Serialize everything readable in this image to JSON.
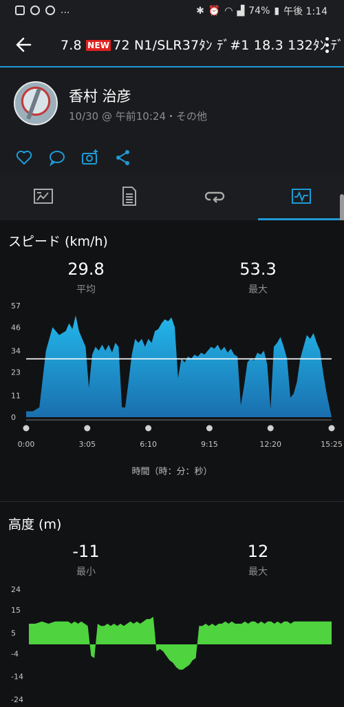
{
  "status": {
    "battery": "74%",
    "time": "午後 1:14",
    "more": "..."
  },
  "header": {
    "title_prefix": "7.8",
    "new_badge": "NEW",
    "title_rest": "72  N1/SLR37ﾀﾝ ﾃﾞ#1  18.3  132ﾀﾝ ﾃﾞ"
  },
  "profile": {
    "name": "香村 治彦",
    "subtitle": "10/30 @ 午前10:24・その他"
  },
  "actions": [
    "like",
    "comment",
    "add-photo",
    "share"
  ],
  "tabs": [
    "summary",
    "details",
    "laps",
    "charts"
  ],
  "speed": {
    "title": "スピード (km/h)",
    "avg_value": "29.8",
    "avg_label": "平均",
    "max_value": "53.3",
    "max_label": "最大",
    "xlabel": "時間（時：分：秒）"
  },
  "altitude": {
    "title": "高度 (m)",
    "min_value": "-11",
    "min_label": "最小",
    "max_value": "12",
    "max_label": "最大"
  },
  "colors": {
    "accent": "#1e9bd7",
    "speed_fill_top": "#22b7ea",
    "speed_fill_bottom": "#1a6fae",
    "alt_fill": "#4fd33f"
  },
  "chart_data": [
    {
      "type": "area",
      "title": "スピード (km/h)",
      "xlabel": "時間（時：分：秒）",
      "ylabel": "",
      "x_ticks": [
        "0:00",
        "3:05",
        "6:10",
        "9:15",
        "12:20",
        "15:25"
      ],
      "y_ticks": [
        0,
        11,
        23,
        34,
        46,
        57
      ],
      "xlim": [
        0,
        925
      ],
      "ylim": [
        0,
        57
      ],
      "average_line": 29.8,
      "series": [
        {
          "x": [
            0,
            20,
            40,
            60,
            80,
            100,
            120,
            130,
            140,
            150,
            160,
            170,
            180,
            190,
            200,
            210,
            220,
            230,
            240,
            250,
            260,
            270,
            280,
            290,
            300,
            310,
            320,
            330,
            340,
            350,
            360,
            370,
            380,
            390,
            400,
            410,
            420,
            430,
            440,
            450,
            460,
            470,
            480,
            490,
            500,
            510,
            520,
            530,
            540,
            550,
            560,
            570,
            580,
            590,
            600,
            610,
            620,
            630,
            640,
            650,
            660,
            670,
            680,
            690,
            700,
            710,
            720,
            730,
            740,
            750,
            760,
            770,
            780,
            790,
            800,
            810,
            820,
            830,
            840,
            850,
            860,
            870,
            880,
            890,
            900,
            910,
            925
          ],
          "y": [
            3,
            3,
            5,
            34,
            46,
            42,
            44,
            48,
            45,
            52,
            44,
            40,
            36,
            15,
            32,
            36,
            34,
            37,
            34,
            37,
            33,
            38,
            36,
            5,
            5,
            18,
            32,
            40,
            38,
            40,
            36,
            40,
            38,
            44,
            45,
            48,
            50,
            49,
            51,
            46,
            20,
            30,
            28,
            31,
            30,
            32,
            31,
            33,
            32,
            34,
            36,
            35,
            37,
            34,
            36,
            33,
            35,
            32,
            31,
            6,
            16,
            28,
            30,
            29,
            33,
            32,
            34,
            27,
            4,
            36,
            38,
            41,
            36,
            30,
            10,
            12,
            18,
            30,
            36,
            42,
            40,
            43,
            38,
            34,
            22,
            12,
            0
          ]
        }
      ]
    },
    {
      "type": "area",
      "title": "高度 (m)",
      "xlabel": "",
      "ylabel": "",
      "y_ticks": [
        24,
        15,
        5,
        -4,
        -14,
        -24
      ],
      "xlim": [
        0,
        925
      ],
      "ylim": [
        -24,
        24
      ],
      "series": [
        {
          "x": [
            0,
            20,
            40,
            60,
            80,
            100,
            120,
            130,
            140,
            150,
            160,
            170,
            180,
            190,
            200,
            210,
            220,
            230,
            240,
            250,
            260,
            270,
            280,
            290,
            300,
            310,
            320,
            330,
            340,
            350,
            360,
            370,
            380,
            390,
            400,
            410,
            420,
            430,
            440,
            450,
            460,
            470,
            480,
            490,
            500,
            510,
            520,
            530,
            540,
            550,
            560,
            570,
            580,
            590,
            600,
            610,
            620,
            630,
            640,
            650,
            660,
            670,
            680,
            690,
            700,
            710,
            720,
            730,
            740,
            750,
            760,
            770,
            780,
            790,
            800,
            810,
            820,
            830,
            840,
            850,
            860,
            870,
            880,
            890,
            900,
            910,
            925
          ],
          "y": [
            9,
            9,
            10,
            9,
            10,
            10,
            10,
            9,
            10,
            9,
            10,
            9,
            8,
            -5,
            -6,
            9,
            8,
            8,
            9,
            8,
            9,
            8,
            9,
            8,
            9,
            10,
            9,
            10,
            9,
            10,
            11,
            11,
            12,
            -3,
            -2,
            -3,
            -5,
            -7,
            -8,
            -10,
            -11,
            -11,
            -10,
            -9,
            -7,
            -6,
            8,
            8,
            9,
            8,
            9,
            8,
            9,
            9,
            10,
            9,
            10,
            9,
            9,
            9,
            10,
            9,
            10,
            10,
            9,
            10,
            9,
            10,
            10,
            9,
            10,
            9,
            10,
            10,
            9,
            10,
            10,
            10,
            10,
            10,
            10,
            10,
            10,
            10,
            10,
            10,
            10
          ]
        }
      ]
    }
  ]
}
